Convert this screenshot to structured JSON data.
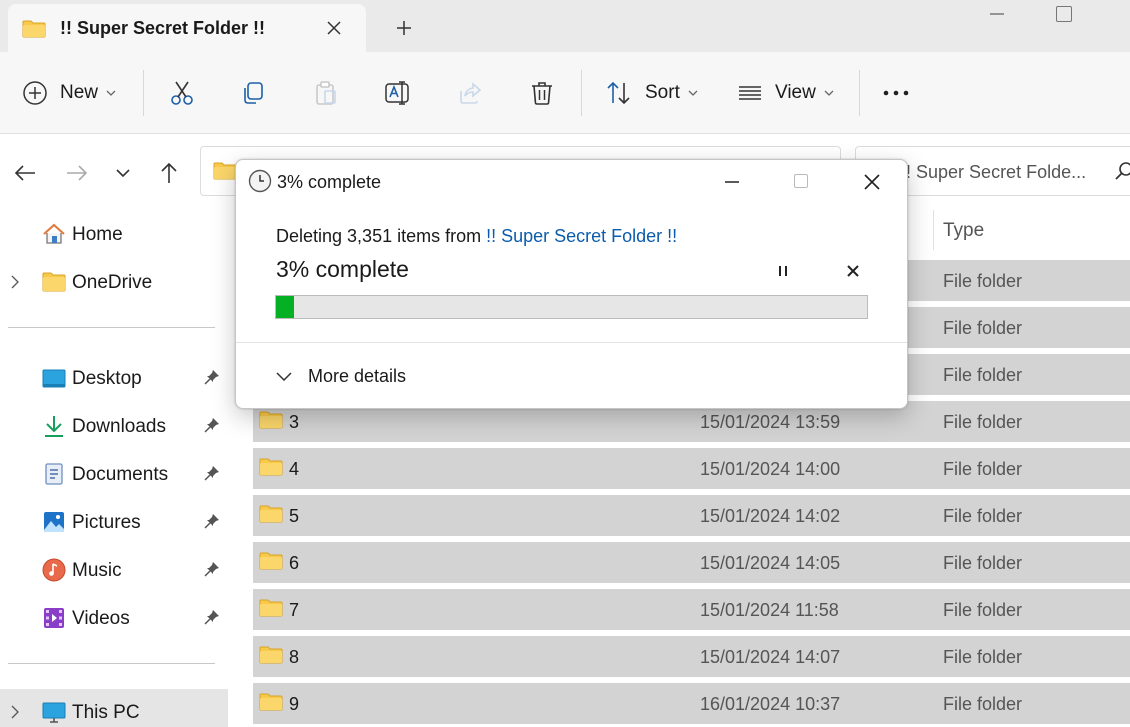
{
  "tab": {
    "title": "!! Super Secret Folder !!"
  },
  "toolbar": {
    "new_label": "New",
    "sort_label": "Sort",
    "view_label": "View"
  },
  "search": {
    "placeholder": "h !! Super Secret Folde..."
  },
  "sidebar": {
    "items": [
      {
        "label": "Home",
        "icon": "home-icon"
      },
      {
        "label": "OneDrive",
        "icon": "folder-icon"
      },
      {
        "label": "Desktop",
        "icon": "desktop-icon"
      },
      {
        "label": "Downloads",
        "icon": "download-icon"
      },
      {
        "label": "Documents",
        "icon": "documents-icon"
      },
      {
        "label": "Pictures",
        "icon": "pictures-icon"
      },
      {
        "label": "Music",
        "icon": "music-icon"
      },
      {
        "label": "Videos",
        "icon": "videos-icon"
      },
      {
        "label": "This PC",
        "icon": "computer-icon"
      }
    ]
  },
  "file_list": {
    "type_header": "Type",
    "rows": [
      {
        "name": "",
        "date": "",
        "type": "File folder"
      },
      {
        "name": "",
        "date": "",
        "type": "File folder"
      },
      {
        "name": "",
        "date": "",
        "type": "File folder"
      },
      {
        "name": "3",
        "date": "15/01/2024 13:59",
        "type": "File folder"
      },
      {
        "name": "4",
        "date": "15/01/2024 14:00",
        "type": "File folder"
      },
      {
        "name": "5",
        "date": "15/01/2024 14:02",
        "type": "File folder"
      },
      {
        "name": "6",
        "date": "15/01/2024 14:05",
        "type": "File folder"
      },
      {
        "name": "7",
        "date": "15/01/2024 11:58",
        "type": "File folder"
      },
      {
        "name": "8",
        "date": "15/01/2024 14:07",
        "type": "File folder"
      },
      {
        "name": "9",
        "date": "16/01/2024 10:37",
        "type": "File folder"
      }
    ]
  },
  "dialog": {
    "window_title": "3% complete",
    "description_prefix": "Deleting 3,351 items from ",
    "description_link": "!! Super Secret Folder !!",
    "progress_title": "3% complete",
    "progress_percent": 3,
    "more_details_label": "More details"
  },
  "colors": {
    "progress_fill": "#06b025",
    "link": "#0b5cad",
    "row_selected": "#d3d3d3",
    "folder": "#f8c94a"
  }
}
